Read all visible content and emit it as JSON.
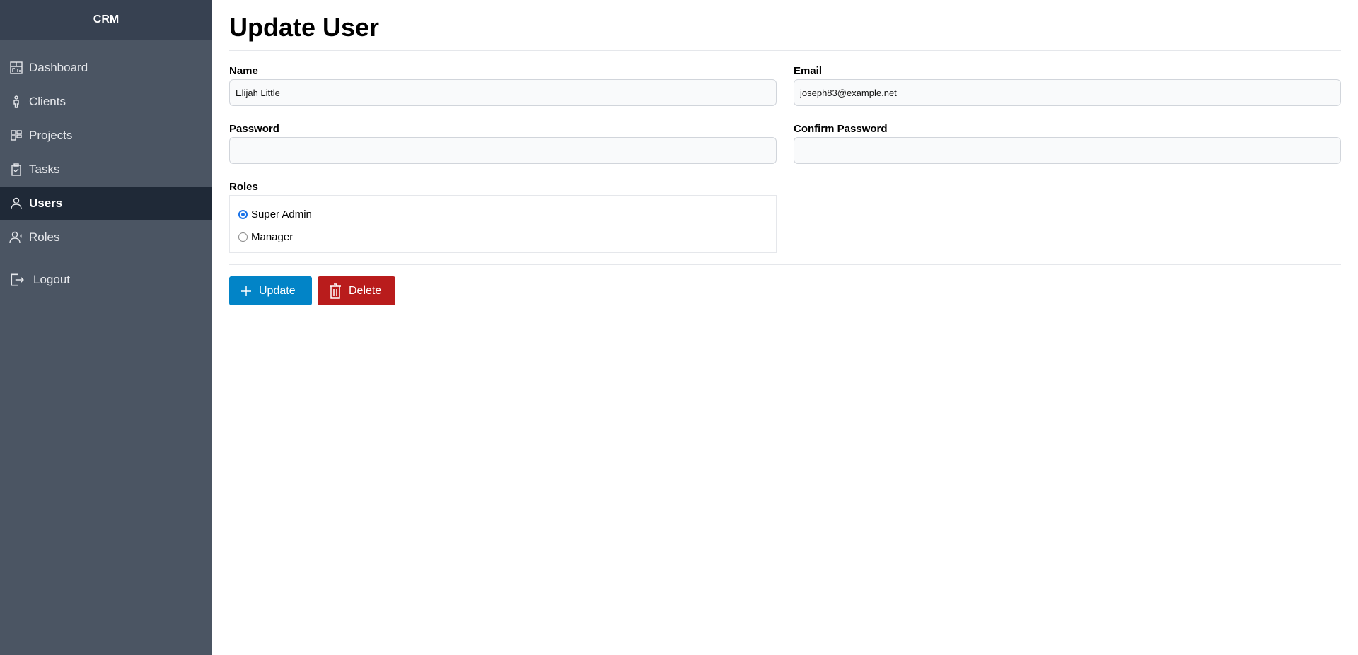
{
  "app": {
    "title": "CRM"
  },
  "sidebar": {
    "items": [
      {
        "label": "Dashboard",
        "icon": "dashboard-icon"
      },
      {
        "label": "Clients",
        "icon": "person-icon"
      },
      {
        "label": "Projects",
        "icon": "grid-icon"
      },
      {
        "label": "Tasks",
        "icon": "clipboard-icon"
      },
      {
        "label": "Users",
        "icon": "user-icon",
        "active": true
      },
      {
        "label": "Roles",
        "icon": "user-roles-icon"
      }
    ],
    "logout": "Logout"
  },
  "page": {
    "title": "Update User"
  },
  "form": {
    "name": {
      "label": "Name",
      "value": "Elijah Little"
    },
    "email": {
      "label": "Email",
      "value": "joseph83@example.net"
    },
    "password": {
      "label": "Password",
      "value": ""
    },
    "confirm": {
      "label": "Confirm Password",
      "value": ""
    },
    "roles": {
      "label": "Roles",
      "options": [
        "Super Admin",
        "Manager"
      ],
      "selected": "Super Admin"
    }
  },
  "actions": {
    "update": "Update",
    "delete": "Delete"
  },
  "colors": {
    "update": "#0284c7",
    "delete": "#b91c1c",
    "sidebar": "#4b5563",
    "active": "#1f2937"
  }
}
